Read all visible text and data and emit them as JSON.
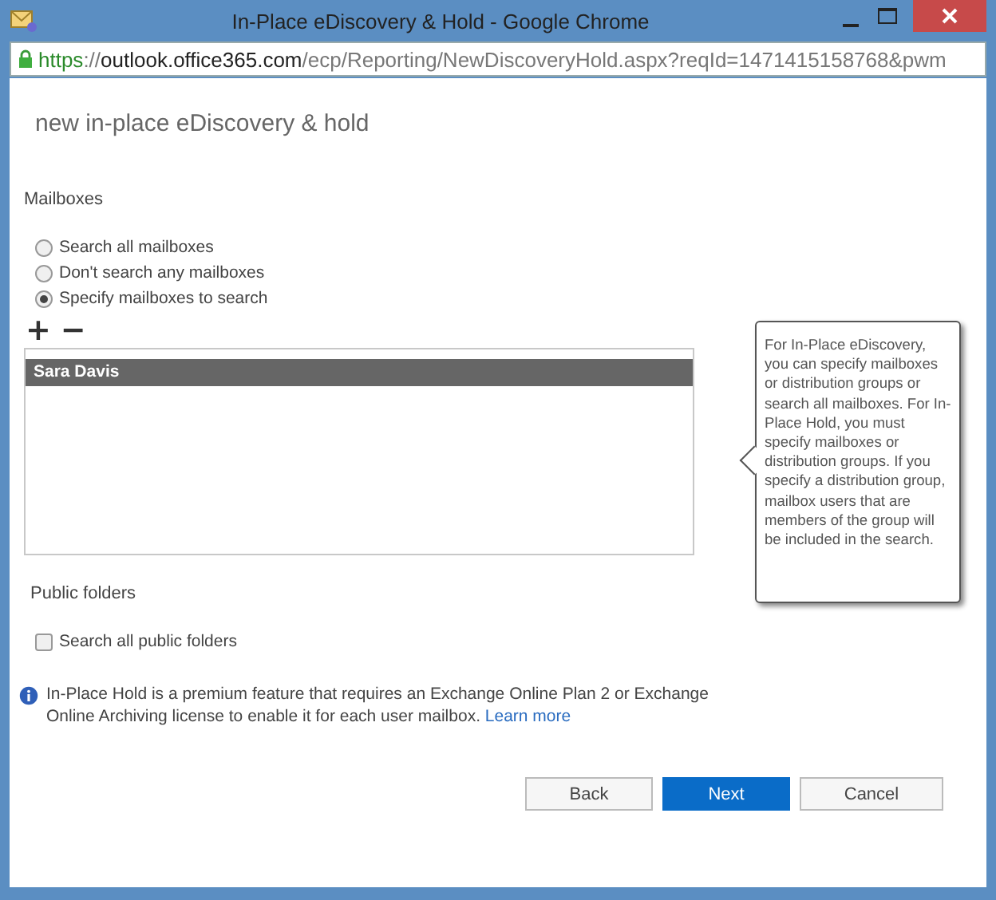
{
  "window": {
    "title": "In-Place eDiscovery & Hold - Google Chrome"
  },
  "address_bar": {
    "scheme": "https",
    "separator": "://",
    "host": "outlook.office365.com",
    "path": "/ecp/Reporting/NewDiscoveryHold.aspx?reqId=1471415158768&pwm"
  },
  "page_title": "new in-place eDiscovery & hold",
  "mailboxes": {
    "heading": "Mailboxes",
    "options": [
      {
        "label": "Search all mailboxes",
        "selected": false
      },
      {
        "label": "Don't search any mailboxes",
        "selected": false
      },
      {
        "label": "Specify mailboxes to search",
        "selected": true
      }
    ],
    "toolbar": [
      "+",
      "−"
    ],
    "list": [
      {
        "name": "Sara Davis",
        "selected": true
      }
    ]
  },
  "tooltip": "For In-Place eDiscovery, you can specify mailboxes or distribution groups or search all mailboxes. For In-Place Hold, you must specify mailboxes or distribution groups. If you specify a distribution group, mailbox users that are members of the group will be included in the search.",
  "public_folders": {
    "heading": "Public folders",
    "checkbox": {
      "label": "Search all public folders",
      "checked": false
    }
  },
  "info": {
    "text": "In-Place Hold is a premium feature that requires an Exchange Online Plan 2 or Exchange Online Archiving license to enable it for each user mailbox.",
    "link": "Learn more"
  },
  "buttons": [
    {
      "label": "Back",
      "primary": false
    },
    {
      "label": "Next",
      "primary": true
    },
    {
      "label": "Cancel",
      "primary": false
    }
  ]
}
